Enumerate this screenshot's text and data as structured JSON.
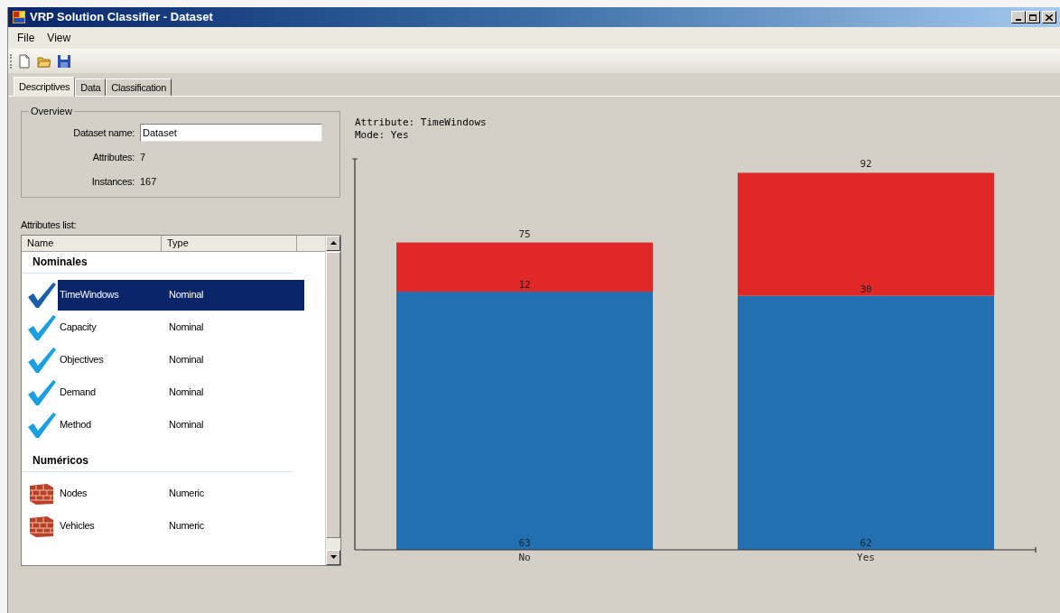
{
  "window": {
    "title": "VRP Solution Classifier - Dataset"
  },
  "menu": [
    "File",
    "View"
  ],
  "toolbar": [
    {
      "kind": "new"
    },
    {
      "kind": "open"
    },
    {
      "kind": "save"
    }
  ],
  "tabs": [
    {
      "label": "Descriptives",
      "selected": true
    },
    {
      "label": "Data",
      "selected": false
    },
    {
      "label": "Classification",
      "selected": false
    }
  ],
  "overview": {
    "title": "Overview",
    "fields": [
      {
        "label": "Dataset name:",
        "value": "Dataset",
        "kind": "input"
      },
      {
        "label": "Attributes:",
        "value": "7",
        "kind": "text"
      },
      {
        "label": "Instances:",
        "value": "167",
        "kind": "text"
      }
    ]
  },
  "attributes_list": {
    "label": "Attributes list:",
    "columns": [
      "Name",
      "Type"
    ],
    "groups": [
      {
        "title": "Nominales",
        "items": [
          {
            "name": "TimeWindows",
            "type": "Nominal",
            "kind": "check",
            "selected": true
          },
          {
            "name": "Capacity",
            "type": "Nominal",
            "kind": "check",
            "selected": false
          },
          {
            "name": "Objectives",
            "type": "Nominal",
            "kind": "check",
            "selected": false
          },
          {
            "name": "Demand",
            "type": "Nominal",
            "kind": "check",
            "selected": false
          },
          {
            "name": "Method",
            "type": "Nominal",
            "kind": "check",
            "selected": false
          }
        ]
      },
      {
        "title": "Numéricos",
        "items": [
          {
            "name": "Nodes",
            "type": "Numeric",
            "kind": "brick",
            "selected": false
          },
          {
            "name": "Vehicles",
            "type": "Numeric",
            "kind": "brick",
            "selected": false
          }
        ]
      }
    ]
  },
  "chart_info": [
    "Attribute: TimeWindows",
    "Mode: Yes"
  ],
  "chart_data": {
    "type": "bar",
    "stacked": true,
    "categories": [
      "No",
      "Yes"
    ],
    "ylim": [
      0,
      95.4
    ],
    "data_labels": true,
    "series": [
      {
        "color": "#2270b2",
        "values": [
          63,
          62
        ]
      },
      {
        "color": "#e02828",
        "values": [
          12,
          30
        ]
      }
    ],
    "annotations": [
      "75",
      "92"
    ]
  }
}
